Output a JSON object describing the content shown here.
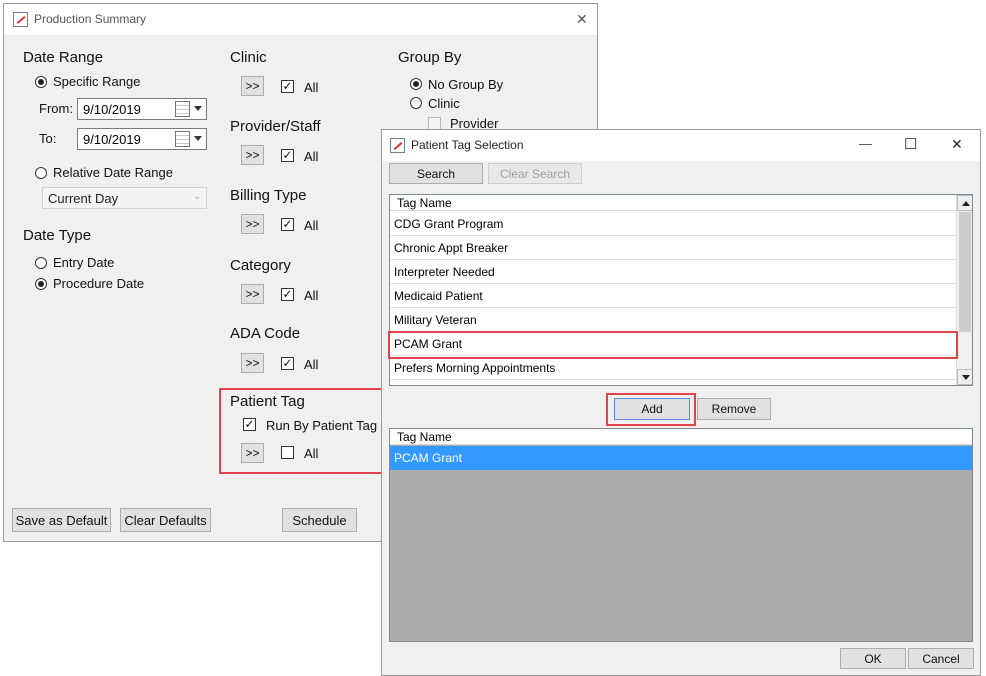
{
  "production_summary": {
    "title": "Production Summary",
    "close_glyph": "✕",
    "date_range": {
      "heading": "Date Range",
      "specific_label": "Specific Range",
      "from_label": "From:",
      "from_value": "9/10/2019",
      "to_label": "To:",
      "to_value": "9/10/2019",
      "relative_label": "Relative Date Range",
      "relative_value": "Current Day"
    },
    "date_type": {
      "heading": "Date Type",
      "entry_label": "Entry Date",
      "procedure_label": "Procedure Date"
    },
    "filters": {
      "arrow_label": ">>",
      "all_label": "All",
      "clinic": "Clinic",
      "provider": "Provider/Staff",
      "billing": "Billing Type",
      "category": "Category",
      "ada": "ADA Code",
      "patient_tag": "Patient Tag",
      "run_by_tag": "Run By Patient Tag"
    },
    "group_by": {
      "heading": "Group By",
      "no_group": "No Group By",
      "clinic": "Clinic",
      "provider": "Provider"
    },
    "footer": {
      "save_default": "Save as Default",
      "clear_defaults": "Clear Defaults",
      "schedule": "Schedule"
    }
  },
  "tag_selection": {
    "title": "Patient Tag Selection",
    "minimize_glyph": "—",
    "maximize_glyph": "☐",
    "close_glyph": "✕",
    "search_label": "Search",
    "clear_search_label": "Clear Search",
    "available_header": "Tag Name",
    "available_tags": [
      "CDG Grant Program",
      "Chronic Appt Breaker",
      "Interpreter Needed",
      "Medicaid Patient",
      "Military Veteran",
      "PCAM Grant",
      "Prefers Morning Appointments"
    ],
    "add_label": "Add",
    "remove_label": "Remove",
    "selected_header": "Tag Name",
    "selected_tags": [
      "PCAM Grant"
    ],
    "ok_label": "OK",
    "cancel_label": "Cancel"
  },
  "colors": {
    "highlight_box": "#e0454e",
    "selected_row": "#3399ff",
    "window_bg": "#f0f0f0",
    "empty_list_bg": "#ababab"
  }
}
